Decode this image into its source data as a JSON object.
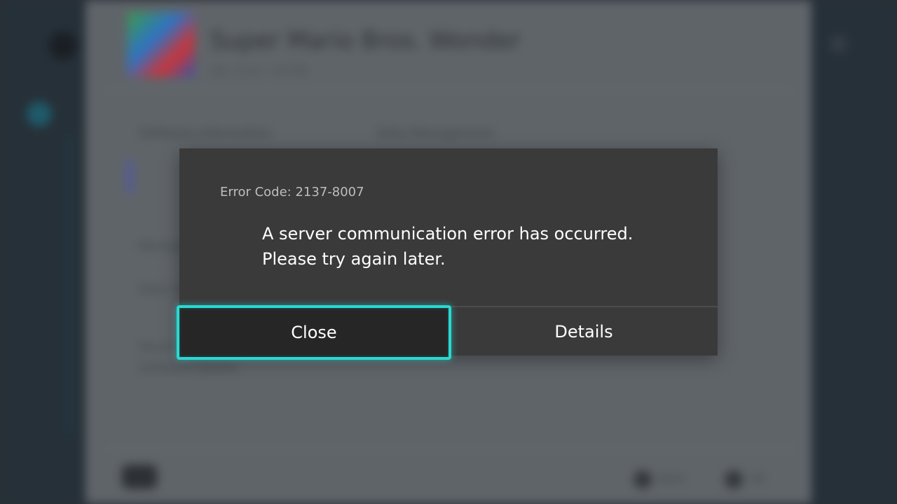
{
  "background": {
    "game_title": "Super Mario Bros. Wonder",
    "game_subtitle": "Ver. 1.0.0 · 4.6 GB",
    "tabs": [
      "Software Information",
      "Data Management"
    ],
    "rows": [
      "Manage Software",
      "Data Cloud",
      "Save Data",
      "Software Update"
    ],
    "footer_buttons": [
      "Back",
      "OK"
    ]
  },
  "dialog": {
    "error_code": "Error Code: 2137-8007",
    "message_lines": [
      "A server communication error has occurred.",
      "Please try again later."
    ],
    "buttons": {
      "close": "Close",
      "details": "Details"
    },
    "focused_button": "close",
    "focus_color": "#2ad8d2"
  }
}
